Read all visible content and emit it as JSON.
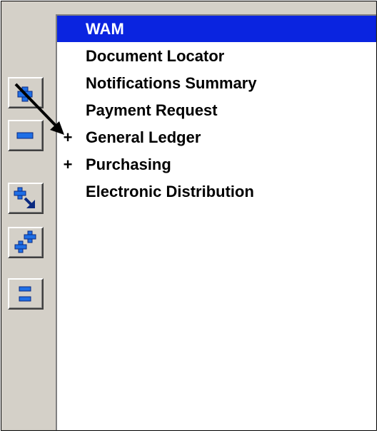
{
  "toolbar": {
    "buttons": [
      {
        "name": "expand-button",
        "icon": "plus-icon"
      },
      {
        "name": "collapse-button",
        "icon": "minus-icon"
      },
      {
        "name": "expand-branch-button",
        "icon": "plus-arrow-down-right-icon"
      },
      {
        "name": "expand-all-button",
        "icon": "double-plus-icon"
      },
      {
        "name": "collapse-all-button",
        "icon": "double-minus-icon"
      }
    ]
  },
  "tree": {
    "items": [
      {
        "label": "WAM",
        "expander": "",
        "selected": true
      },
      {
        "label": "Document Locator",
        "expander": ""
      },
      {
        "label": "Notifications Summary",
        "expander": ""
      },
      {
        "label": "Payment Request",
        "expander": ""
      },
      {
        "label": "General Ledger",
        "expander": "+"
      },
      {
        "label": "Purchasing",
        "expander": "+"
      },
      {
        "label": "Electronic Distribution",
        "expander": ""
      }
    ]
  },
  "colors": {
    "selection": "#0a24e0",
    "icon_blue": "#1f6fe6",
    "panel": "#d4d0c8"
  }
}
